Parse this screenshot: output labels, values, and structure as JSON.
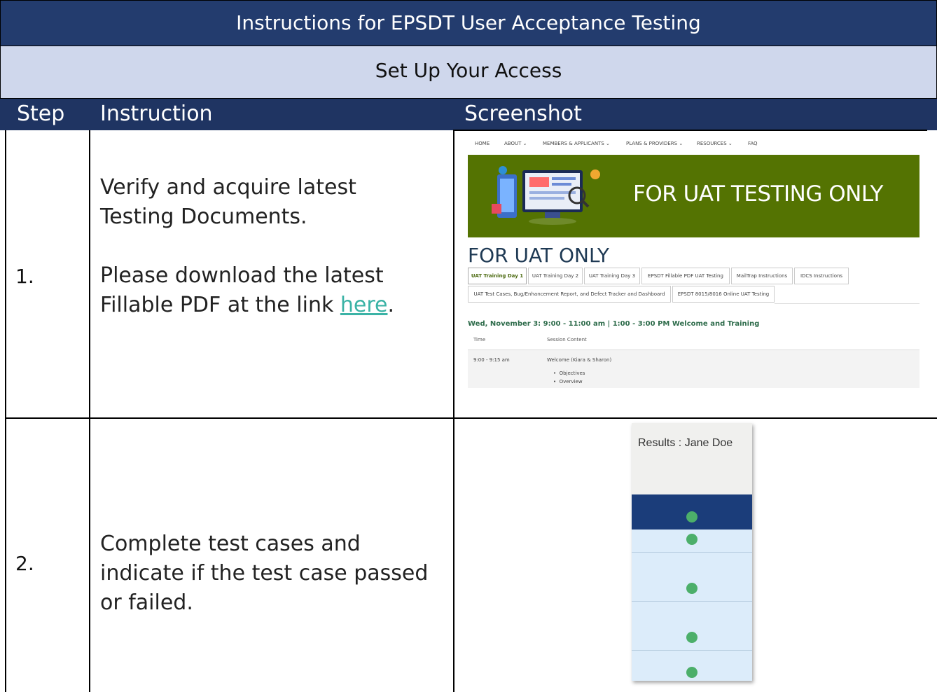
{
  "doc_title": "Instructions for EPSDT User Acceptance Testing",
  "section_title": "Set Up Your Access",
  "columns": [
    "Step",
    "Instruction",
    "Screenshot"
  ],
  "rows": [
    {
      "step": "1.",
      "instruction_p1": "Verify and acquire latest Testing Documents.",
      "instruction_p2_before": "Please download the latest Fillable PDF at the link ",
      "link_text": "here",
      "instruction_p2_after": "."
    },
    {
      "step": "2.",
      "instruction": "Complete test cases and indicate if the test case passed or failed."
    }
  ],
  "screenshot1": {
    "nav_items": [
      "HOME",
      "ABOUT ⌄",
      "MEMBERS & APPLICANTS ⌄",
      "PLANS & PROVIDERS ⌄",
      "RESOURCES ⌄",
      "FAQ"
    ],
    "banner_text": "FOR UAT TESTING ONLY",
    "page_title": "FOR UAT ONLY",
    "tabs_row1": [
      "UAT Training Day 1",
      "UAT Training Day 2",
      "UAT Training Day 3",
      "EPSDT Fillable PDF UAT Testing",
      "MailTrap Instructions",
      "IDCS Instructions"
    ],
    "tabs_row2": [
      "UAT Test Cases, Bug/Enhancement Report, and Defect Tracker and Dashboard",
      "EPSDT 8015/8016 Online UAT Testing"
    ],
    "day_heading": "Wed, November 3: 9:00 - 11:00 am | 1:00 - 3:00 PM   Welcome and Training",
    "table_headers": [
      "Time",
      "Session Content"
    ],
    "row_time": "9:00 - 9:15 am",
    "row_content": "Welcome (Kiara & Sharon)",
    "bullets": [
      "Objectives",
      "Overview"
    ]
  },
  "screenshot2": {
    "results_label": "Results : Jane Doe"
  }
}
